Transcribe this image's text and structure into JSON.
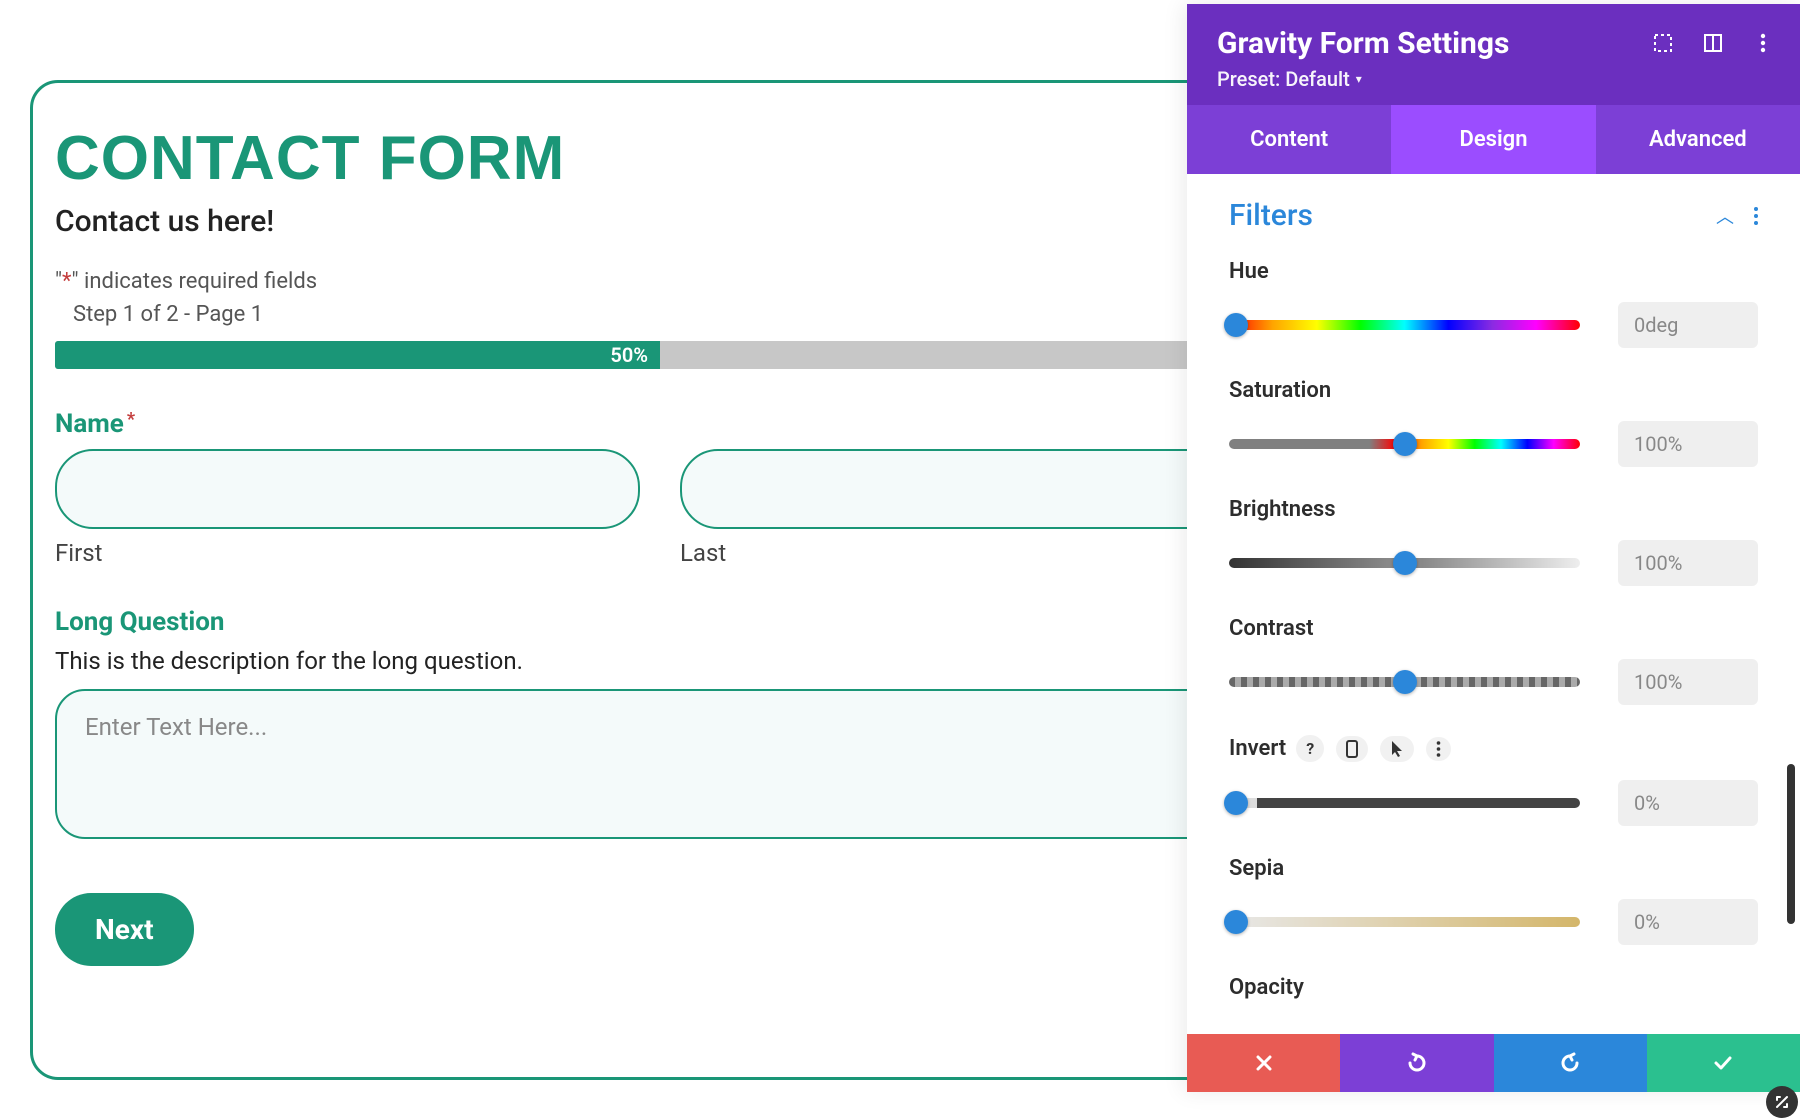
{
  "form": {
    "title": "CONTACT FORM",
    "subtitle": "Contact us here!",
    "required_note_pre": "\"",
    "required_note_ast": "*",
    "required_note_post": "\" indicates required fields",
    "step_note": "Step 1 of 2 - Page 1",
    "progress_label": "50%",
    "progress_pct": 50,
    "name_label": "Name",
    "name_required": "*",
    "first_sub": "First",
    "last_sub": "Last",
    "question_label": "Long Question",
    "question_desc": "This is the description for the long question.",
    "textarea_placeholder": "Enter Text Here...",
    "next_button": "Next"
  },
  "panel": {
    "title": "Gravity Form Settings",
    "preset": "Preset: Default",
    "tabs": {
      "content": "Content",
      "design": "Design",
      "advanced": "Advanced"
    },
    "section_title": "Filters",
    "filters": {
      "hue": {
        "label": "Hue",
        "value": "0deg",
        "thumb_pct": 2
      },
      "saturation": {
        "label": "Saturation",
        "value": "100%",
        "thumb_pct": 50
      },
      "brightness": {
        "label": "Brightness",
        "value": "100%",
        "thumb_pct": 50
      },
      "contrast": {
        "label": "Contrast",
        "value": "100%",
        "thumb_pct": 50
      },
      "invert": {
        "label": "Invert",
        "value": "0%",
        "thumb_pct": 2
      },
      "sepia": {
        "label": "Sepia",
        "value": "0%",
        "thumb_pct": 2
      },
      "opacity": {
        "label": "Opacity"
      }
    },
    "invert_help": "?"
  }
}
